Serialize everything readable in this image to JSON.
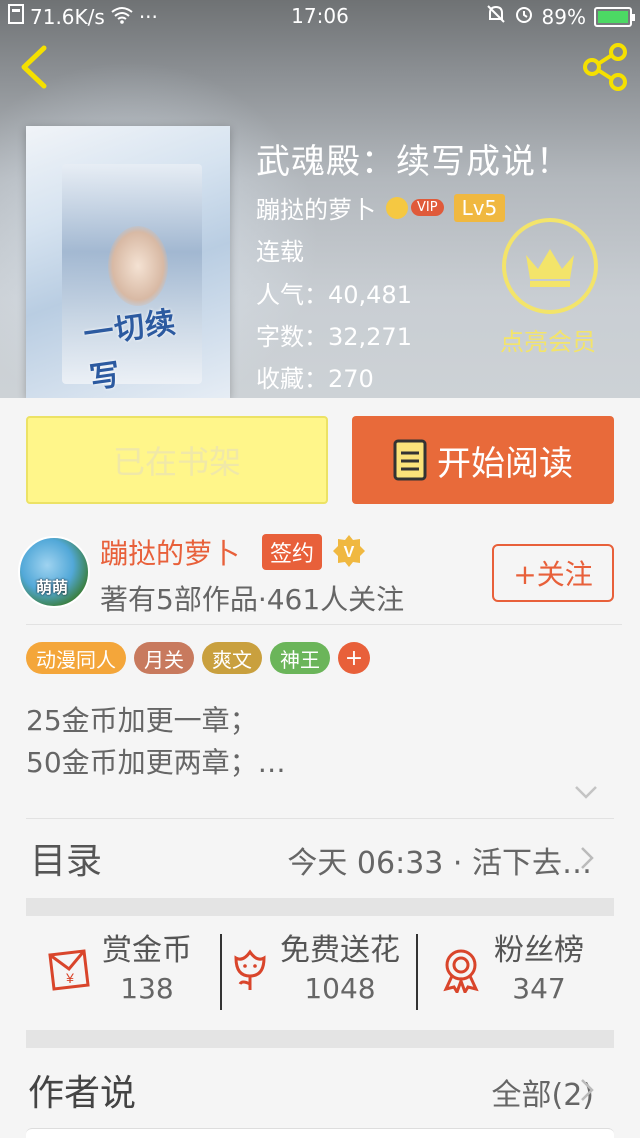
{
  "status_bar": {
    "speed": "71.6K/s",
    "dots": "···",
    "time": "17:06",
    "battery": "89%"
  },
  "book": {
    "title": "武魂殿：续写成说！",
    "author": "蹦挞的萝卜",
    "vip": "VIP",
    "level": "Lv5",
    "status": "连载",
    "popularity": "人气：40,481",
    "word_count": "字数：32,271",
    "favorites": "收藏：270"
  },
  "member": {
    "label": "点亮会员"
  },
  "actions": {
    "shelf": "已在书架",
    "read": "开始阅读"
  },
  "author_card": {
    "name": "蹦挞的萝卜",
    "sign": "签约",
    "stats": "著有5部作品·461人关注",
    "follow": "+关注"
  },
  "tags": [
    {
      "label": "动漫同人",
      "color": "#f4a63a"
    },
    {
      "label": "月关",
      "color": "#c87a5e"
    },
    {
      "label": "爽文",
      "color": "#c9a03e"
    },
    {
      "label": "神王",
      "color": "#6bb55a"
    }
  ],
  "tag_more": "+",
  "description": {
    "line1": "25金币加更一章；",
    "line2": "50金币加更两章；…"
  },
  "toc": {
    "title": "目录",
    "latest": "今天 06:33 · 活下去…"
  },
  "stats": {
    "reward": {
      "label": "赏金币",
      "value": "138"
    },
    "flowers": {
      "label": "免费送花",
      "value": "1048"
    },
    "fans": {
      "label": "粉丝榜",
      "value": "347"
    }
  },
  "author_says": {
    "title": "作者说",
    "all": "全部(2)"
  },
  "colors": {
    "accent": "#e8603a",
    "shelf_bg": "#fff68a",
    "member_yellow": "#f3e46a"
  }
}
